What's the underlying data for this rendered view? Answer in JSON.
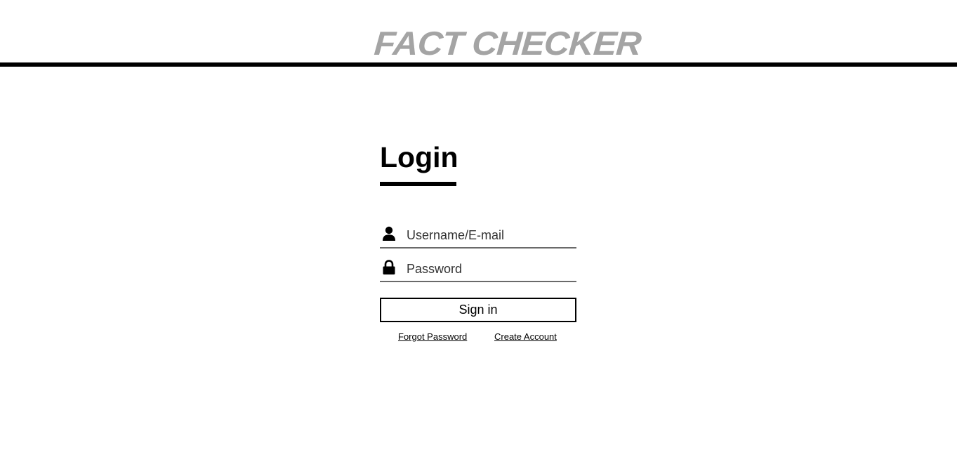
{
  "header": {
    "brand": "FACT CHECKER"
  },
  "login": {
    "title": "Login",
    "username": {
      "placeholder": "Username/E-mail",
      "icon": "user-icon"
    },
    "password": {
      "placeholder": "Password",
      "icon": "lock-icon"
    },
    "signin_label": "Sign in",
    "forgot_label": "Forgot Password",
    "create_label": "Create Account"
  },
  "colors": {
    "brand_text": "#a4a4a4",
    "rule": "#000000",
    "field_border": "#6a6a6a"
  }
}
